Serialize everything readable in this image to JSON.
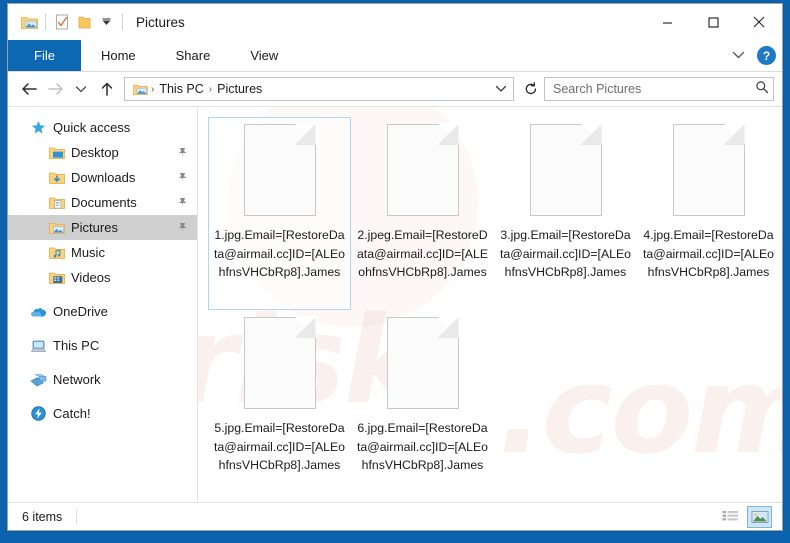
{
  "window": {
    "title": "Pictures",
    "quick_access_toolbar": [
      {
        "name": "pictures-folder-icon",
        "label": "Pictures"
      },
      {
        "name": "properties-icon",
        "label": "Properties"
      },
      {
        "name": "new-folder-icon",
        "label": "New folder"
      },
      {
        "name": "customize-dropdown-icon",
        "label": "Customize Quick Access Toolbar"
      }
    ],
    "controls": {
      "minimize": "–",
      "maximize": "☐",
      "close": "✕"
    }
  },
  "ribbon": {
    "tabs": [
      {
        "label": "File",
        "active": true
      },
      {
        "label": "Home",
        "active": false
      },
      {
        "label": "Share",
        "active": false
      },
      {
        "label": "View",
        "active": false
      }
    ],
    "expand_label": "⌄",
    "help_label": "?"
  },
  "navbar": {
    "back": "←",
    "forward": "→",
    "recent": "⌄",
    "up": "↑",
    "breadcrumbs": [
      "This PC",
      "Pictures"
    ],
    "breadcrumb_separator": "›",
    "dropdown": "⌄",
    "refresh": "↻",
    "search_placeholder": "Search Pictures",
    "search_value": "",
    "search_icon": "🔍"
  },
  "sidebar": {
    "items": [
      {
        "label": "Quick access",
        "icon": "star-icon",
        "level": 0,
        "pinned": false,
        "selected": false
      },
      {
        "label": "Desktop",
        "icon": "desktop-folder-icon",
        "level": 1,
        "pinned": true,
        "selected": false
      },
      {
        "label": "Downloads",
        "icon": "downloads-folder-icon",
        "level": 1,
        "pinned": true,
        "selected": false
      },
      {
        "label": "Documents",
        "icon": "documents-folder-icon",
        "level": 1,
        "pinned": true,
        "selected": false
      },
      {
        "label": "Pictures",
        "icon": "pictures-folder-icon",
        "level": 1,
        "pinned": true,
        "selected": true
      },
      {
        "label": "Music",
        "icon": "music-folder-icon",
        "level": 1,
        "pinned": false,
        "selected": false
      },
      {
        "label": "Videos",
        "icon": "videos-folder-icon",
        "level": 1,
        "pinned": false,
        "selected": false
      },
      {
        "label": "OneDrive",
        "icon": "onedrive-cloud-icon",
        "level": 0,
        "pinned": false,
        "selected": false,
        "gap_before": true
      },
      {
        "label": "This PC",
        "icon": "this-pc-icon",
        "level": 0,
        "pinned": false,
        "selected": false,
        "gap_before": true
      },
      {
        "label": "Network",
        "icon": "network-icon",
        "level": 0,
        "pinned": false,
        "selected": false,
        "gap_before": true
      },
      {
        "label": "Catch!",
        "icon": "catch-app-icon",
        "level": 0,
        "pinned": false,
        "selected": false,
        "gap_before": true
      }
    ]
  },
  "content": {
    "files": [
      {
        "name": "1.jpg.Email=[RestoreData@airmail.cc]ID=[ALEohfnsVHCbRp8].James",
        "icon": "blank-document-icon",
        "selected": true
      },
      {
        "name": "2.jpeg.Email=[RestoreData@airmail.cc]ID=[ALEohfnsVHCbRp8].James",
        "icon": "blank-document-icon",
        "selected": false
      },
      {
        "name": "3.jpg.Email=[RestoreData@airmail.cc]ID=[ALEohfnsVHCbRp8].James",
        "icon": "blank-document-icon",
        "selected": false
      },
      {
        "name": "4.jpg.Email=[RestoreData@airmail.cc]ID=[ALEohfnsVHCbRp8].James",
        "icon": "blank-document-icon",
        "selected": false
      },
      {
        "name": "5.jpg.Email=[RestoreData@airmail.cc]ID=[ALEohfnsVHCbRp8].James",
        "icon": "blank-document-icon",
        "selected": false
      },
      {
        "name": "6.jpg.Email=[RestoreData@airmail.cc]ID=[ALEohfnsVHCbRp8].James",
        "icon": "blank-document-icon",
        "selected": false
      }
    ]
  },
  "statusbar": {
    "item_count": "6 items",
    "views": [
      {
        "name": "details-view-button",
        "active": false
      },
      {
        "name": "large-icons-view-button",
        "active": true
      }
    ]
  },
  "colors": {
    "accent": "#0c68b2",
    "desktop": "#0a63ac",
    "selection_border": "#b4d5ee",
    "sidebar_selected": "#cfcfcf"
  }
}
